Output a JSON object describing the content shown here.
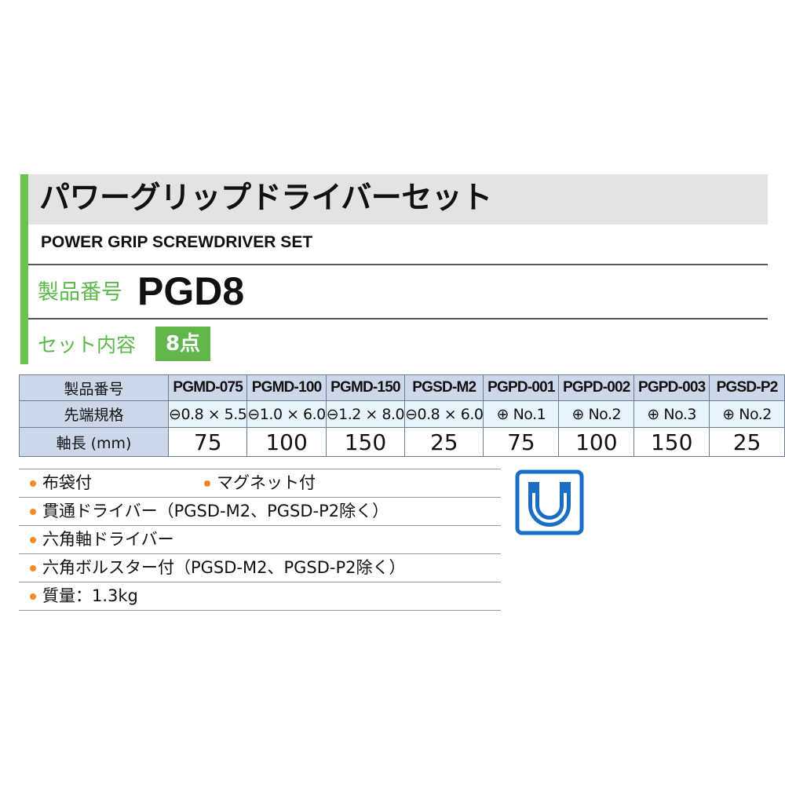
{
  "header": {
    "title_jp": "パワーグリップドライバーセット",
    "title_en": "POWER GRIP SCREWDRIVER SET",
    "product_code_label": "製品番号",
    "product_code": "PGD8",
    "set_contents_label": "セット内容",
    "set_contents_value": "8点"
  },
  "spec_table": {
    "row_labels": {
      "code": "製品番号",
      "tip": "先端規格",
      "length": "軸長 (mm)"
    },
    "items": [
      {
        "code": "PGMD-075",
        "tip": "⊖0.8 × 5.5",
        "length": "75"
      },
      {
        "code": "PGMD-100",
        "tip": "⊖1.0 × 6.0",
        "length": "100"
      },
      {
        "code": "PGMD-150",
        "tip": "⊖1.2 × 8.0",
        "length": "150"
      },
      {
        "code": "PGSD-M2",
        "tip": "⊖0.8 × 6.0",
        "length": "25"
      },
      {
        "code": "PGPD-001",
        "tip": "⊕ No.1",
        "length": "75"
      },
      {
        "code": "PGPD-002",
        "tip": "⊕ No.2",
        "length": "100"
      },
      {
        "code": "PGPD-003",
        "tip": "⊕ No.3",
        "length": "150"
      },
      {
        "code": "PGSD-P2",
        "tip": "⊕ No.2",
        "length": "25"
      }
    ]
  },
  "features": {
    "row1_a": "布袋付",
    "row1_b": "マグネット付",
    "row2": "貫通ドライバー（PGSD-M2、PGSD-P2除く）",
    "row3": "六角軸ドライバー",
    "row4": "六角ボルスター付（PGSD-M2、PGSD-P2除く）",
    "row5": "質量：1.3kg"
  },
  "icons": {
    "magnet": "magnet-icon"
  },
  "colors": {
    "accent_green": "#62b64b",
    "bullet_orange": "#f08a24",
    "magnet_blue": "#1a6fc4",
    "table_header": "#ccd7ea",
    "table_cell": "#e8f4fb"
  }
}
